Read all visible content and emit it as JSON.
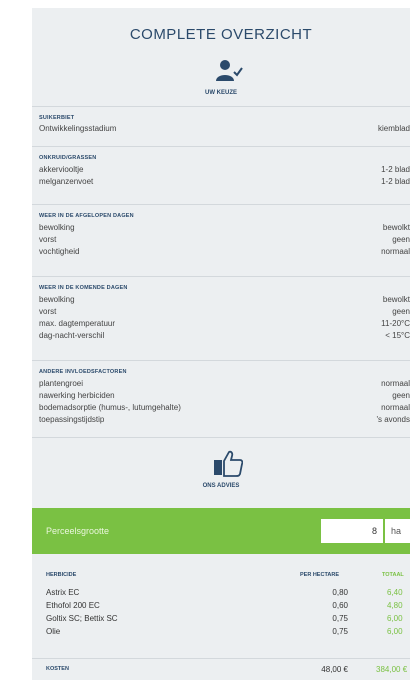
{
  "title": "COMPLETE OVERZICHT",
  "choice_label": "UW KEUZE",
  "sections": [
    {
      "heading": "SUIKERBIET",
      "rows": [
        {
          "label": "Ontwikkelingsstadium",
          "value": "kiemblad"
        }
      ]
    },
    {
      "heading": "ONKRUID/GRASSEN",
      "rows": [
        {
          "label": "akkerviooltje",
          "value": "1-2 blad"
        },
        {
          "label": "melganzenvoet",
          "value": "1-2 blad"
        }
      ]
    },
    {
      "heading": "WEER IN DE AFGELOPEN DAGEN",
      "rows": [
        {
          "label": "bewolking",
          "value": "bewolkt"
        },
        {
          "label": "vorst",
          "value": "geen"
        },
        {
          "label": "vochtigheid",
          "value": "normaal"
        }
      ]
    },
    {
      "heading": "WEER IN DE KOMENDE DAGEN",
      "rows": [
        {
          "label": "bewolking",
          "value": "bewolkt"
        },
        {
          "label": "vorst",
          "value": "geen"
        },
        {
          "label": "max. dagtemperatuur",
          "value": "11-20°C"
        },
        {
          "label": "dag-nacht-verschil",
          "value": "< 15°C"
        }
      ]
    },
    {
      "heading": "ANDERE INVLOEDSFACTOREN",
      "rows": [
        {
          "label": "plantengroei",
          "value": "normaal"
        },
        {
          "label": "nawerking herbiciden",
          "value": "geen"
        },
        {
          "label": "bodemadsorptie (humus-, lutumgehalte)",
          "value": "normaal"
        },
        {
          "label": "toepassingstijdstip",
          "value": "'s avonds"
        }
      ]
    }
  ],
  "advice_label": "ONS ADVIES",
  "parcel": {
    "label": "Perceelsgrootte",
    "value": "8",
    "unit": "ha"
  },
  "herbicide_table": {
    "col_herbicide": "HERBICIDE",
    "col_per_hectare": "PER HECTARE",
    "col_total": "TOTAAL",
    "rows": [
      {
        "name": "Astrix EC",
        "per_hectare": "0,80",
        "total": "6,40"
      },
      {
        "name": "Ethofol 200 EC",
        "per_hectare": "0,60",
        "total": "4,80"
      },
      {
        "name": "Goltix SC; Bettix SC",
        "per_hectare": "0,75",
        "total": "6,00"
      },
      {
        "name": "Olie",
        "per_hectare": "0,75",
        "total": "6,00"
      }
    ]
  },
  "costs": {
    "label": "KOSTEN",
    "per_hectare": "48,00 €",
    "total": "384,00 €"
  },
  "colors": {
    "accent_green": "#7ac143",
    "heading_blue": "#2b4a6b"
  }
}
